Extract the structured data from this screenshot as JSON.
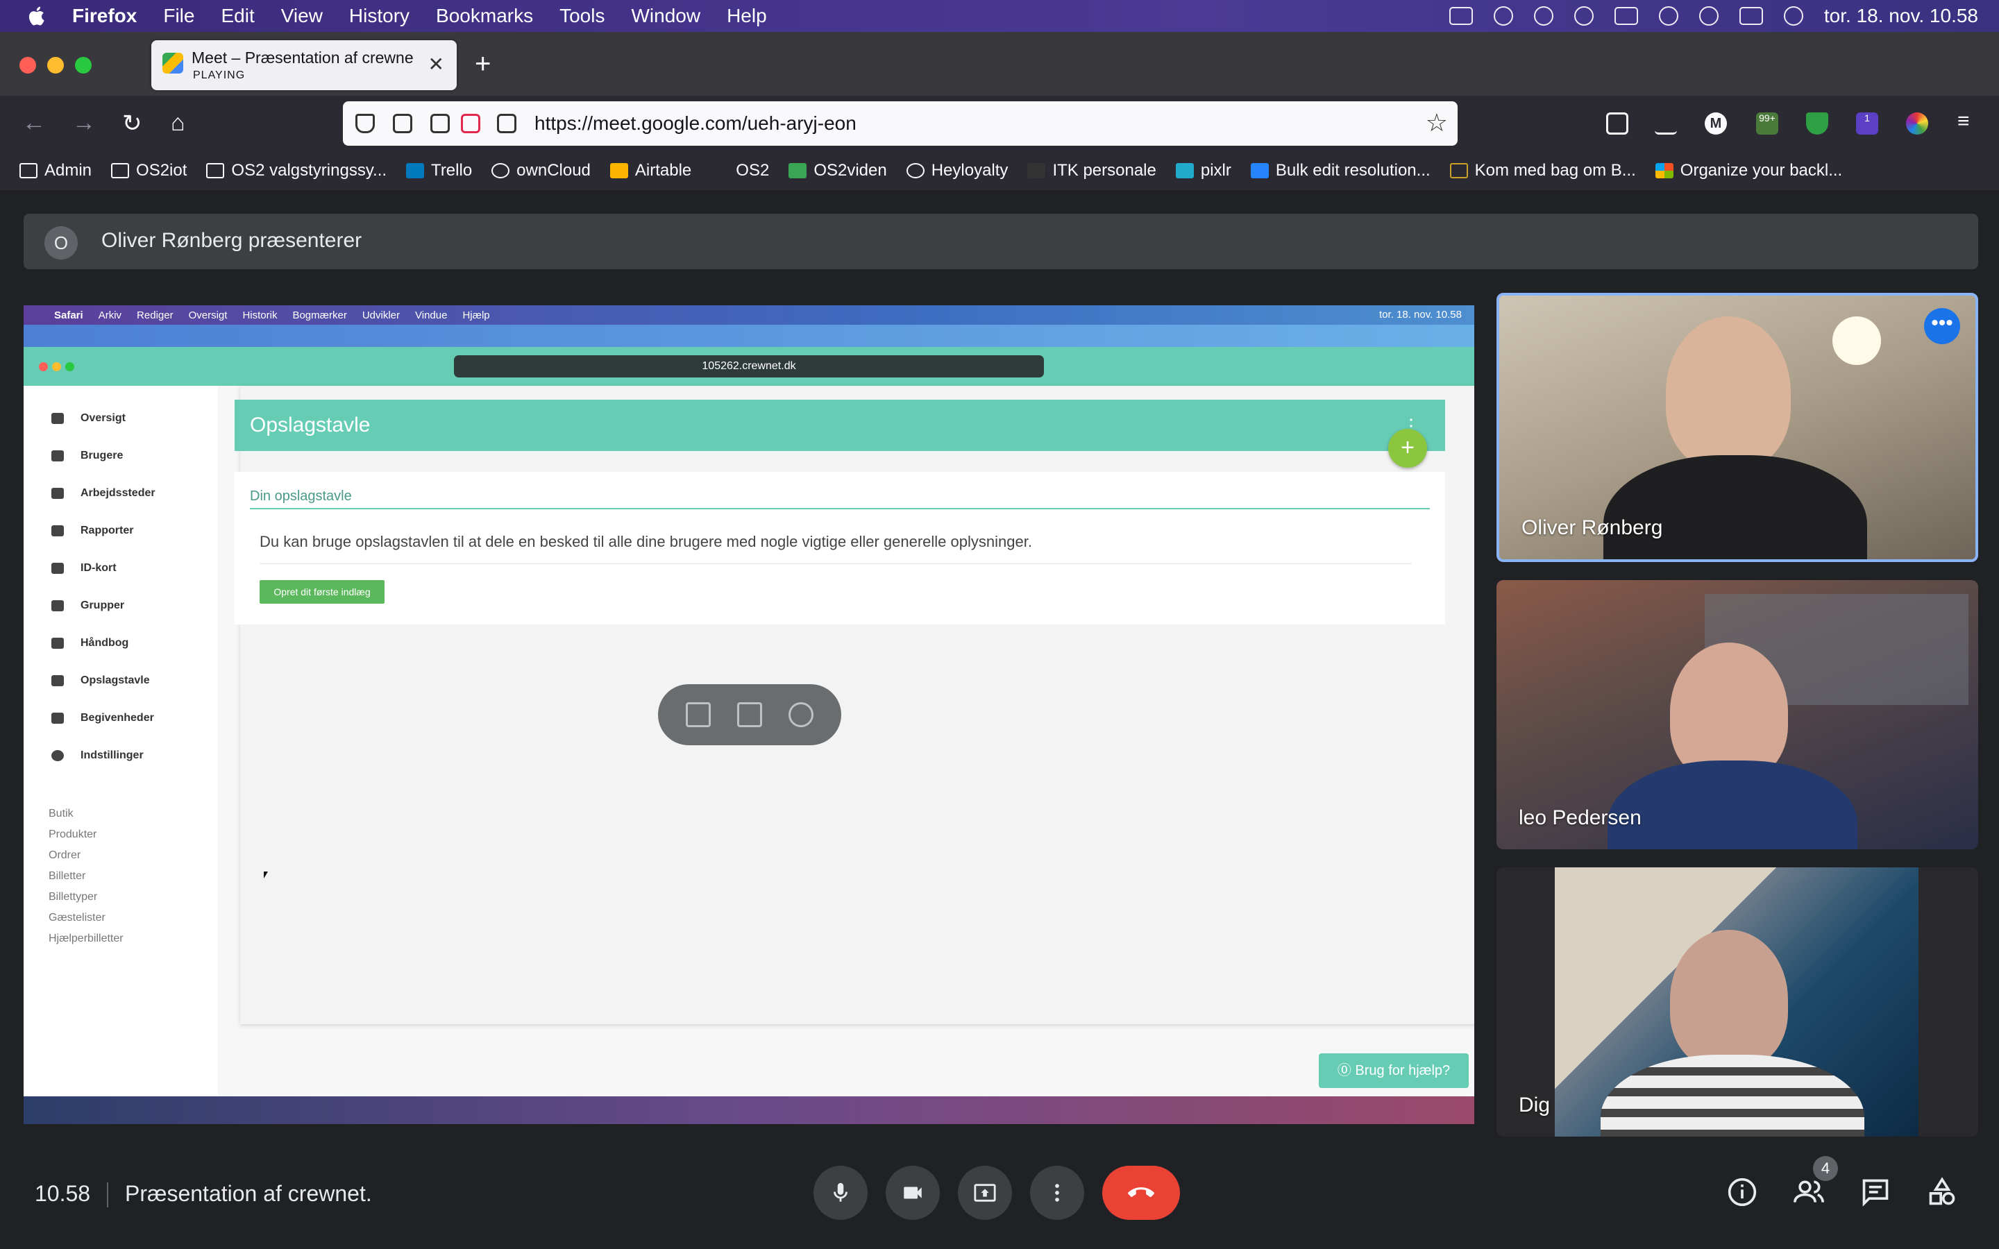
{
  "mac_menubar": {
    "app_name": "Firefox",
    "items": [
      "File",
      "Edit",
      "View",
      "History",
      "Bookmarks",
      "Tools",
      "Window",
      "Help"
    ],
    "clock": "tor. 18. nov. 10.58"
  },
  "browser": {
    "tab": {
      "title": "Meet – Præsentation af crewnet.",
      "status": "PLAYING"
    },
    "url": "https://meet.google.com/ueh-aryj-eon",
    "toolbar_badges": {
      "extension_count": "99+",
      "extension_badge_2": "1"
    },
    "account_initial": "M",
    "bookmarks": [
      "Admin",
      "OS2iot",
      "OS2 valgstyringssy...",
      "Trello",
      "ownCloud",
      "Airtable",
      "OS2",
      "OS2viden",
      "Heyloyalty",
      "ITK personale",
      "pixlr",
      "Bulk edit resolution...",
      "Kom med bag om B...",
      "Organize your backl..."
    ]
  },
  "meet": {
    "presenter_initial": "O",
    "presenter_text": "Oliver Rønberg præsenterer",
    "participants": [
      {
        "name": "Oliver Rønberg"
      },
      {
        "name": "leo Pedersen"
      },
      {
        "name": "Dig"
      }
    ],
    "bottom": {
      "time": "10.58",
      "meeting_title": "Præsentation af crewnet.",
      "people_count": "4"
    }
  },
  "shared_screen": {
    "menubar": {
      "app": "Safari",
      "items": [
        "Arkiv",
        "Rediger",
        "Oversigt",
        "Historik",
        "Bogmærker",
        "Udvikler",
        "Vindue",
        "Hjælp"
      ],
      "clock": "tor. 18. nov. 10.58"
    },
    "url": "105262.crewnet.dk",
    "sidebar": {
      "nav": [
        "Oversigt",
        "Brugere",
        "Arbejdssteder",
        "Rapporter",
        "ID-kort",
        "Grupper",
        "Håndbog",
        "Opslagstavle",
        "Begivenheder",
        "Indstillinger"
      ],
      "shop": [
        "Butik",
        "Produkter",
        "Ordrer",
        "Billetter",
        "Billettyper",
        "Gæstelister",
        "Hjælperbilletter"
      ]
    },
    "header_title": "Opslagstavle",
    "card": {
      "title": "Din opslagstavle",
      "text": "Du kan bruge opslagstavlen til at dele en besked til alle dine brugere med nogle vigtige eller generelle oplysninger.",
      "button": "Opret dit første indlæg"
    },
    "help_button": "⓪ Brug for hjælp?"
  }
}
